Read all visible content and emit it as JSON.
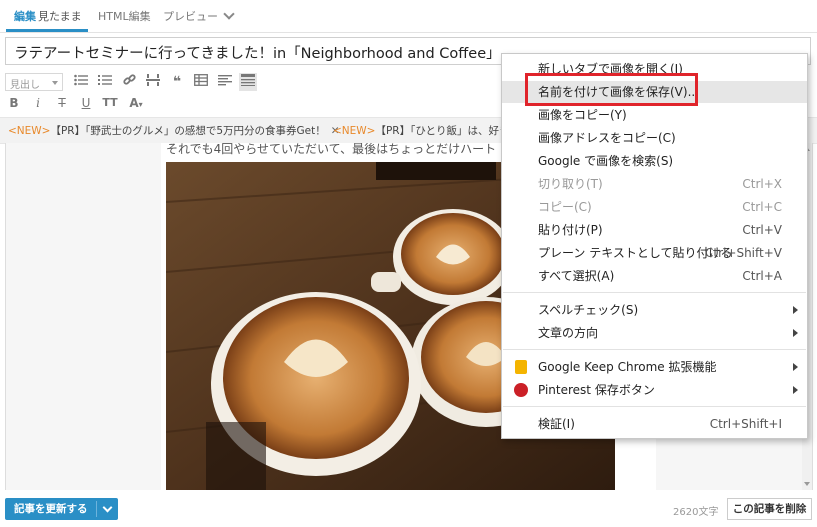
{
  "tabs": {
    "edit_label": "編集",
    "edit_sub": "見たまま",
    "html_label": "HTML編集",
    "preview_label": "プレビュー"
  },
  "title": {
    "value": "ラテアートセミナーに行ってきました！in「Neighborhood and Coffee」"
  },
  "toolbar": {
    "format_select_value": "見出し",
    "icons": [
      "list-bulleted-icon",
      "list-numbered-icon",
      "link-icon",
      "more-separator-icon",
      "quote-icon",
      "table-icon",
      "align-icon",
      "image-box-icon",
      "bold-icon",
      "italic-icon",
      "strikethrough-icon",
      "underline-icon",
      "font-size-icon",
      "text-color-icon"
    ]
  },
  "adbar": {
    "items": [
      {
        "badge": "<NEW>",
        "text": "【PR】「野武士のグルメ」の感想で5万円分の食事券Get！"
      },
      {
        "badge": "<NEW>",
        "text": "【PR】「ひとり飯」は、好き"
      }
    ],
    "close_glyph": "✕"
  },
  "editor": {
    "body_text": "それでも4回やらせていただいて、最後はちょっとだけハート"
  },
  "context_menu": {
    "items": [
      {
        "label": "新しいタブで画像を開く(I)",
        "shortcut": "",
        "disabled": false
      },
      {
        "label": "名前を付けて画像を保存(V)...",
        "shortcut": "",
        "disabled": false,
        "highlighted": true
      },
      {
        "label": "画像をコピー(Y)",
        "shortcut": "",
        "disabled": false
      },
      {
        "label": "画像アドレスをコピー(C)",
        "shortcut": "",
        "disabled": false
      },
      {
        "label": "Google で画像を検索(S)",
        "shortcut": "",
        "disabled": false
      },
      {
        "label": "切り取り(T)",
        "shortcut": "Ctrl+X",
        "disabled": true
      },
      {
        "label": "コピー(C)",
        "shortcut": "Ctrl+C",
        "disabled": true
      },
      {
        "label": "貼り付け(P)",
        "shortcut": "Ctrl+V",
        "disabled": false
      },
      {
        "label": "プレーン テキストとして貼り付ける",
        "shortcut": "Ctrl+Shift+V",
        "disabled": false
      },
      {
        "label": "すべて選択(A)",
        "shortcut": "Ctrl+A",
        "disabled": false
      },
      {
        "label": "スペルチェック(S)",
        "submenu": true
      },
      {
        "label": "文章の方向",
        "submenu": true
      },
      {
        "label": "Google Keep Chrome 拡張機能",
        "submenu": true,
        "icon": "google-keep-icon"
      },
      {
        "label": "Pinterest 保存ボタン",
        "submenu": true,
        "icon": "pinterest-icon"
      },
      {
        "label": "検証(I)",
        "shortcut": "Ctrl+Shift+I"
      }
    ]
  },
  "footer": {
    "update_label": "記事を更新する",
    "char_count": "2620文字",
    "delete_label": "この記事を削除"
  },
  "colors": {
    "accent": "#2a8fc6",
    "badge": "#e8892b",
    "highlight_border": "#e0242b",
    "keep_yellow": "#f4b400",
    "pinterest_red": "#cb2027"
  }
}
